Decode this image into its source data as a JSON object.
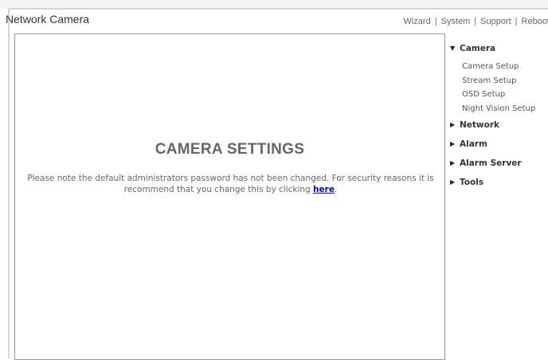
{
  "header": {
    "title": "Network Camera",
    "nav": [
      "Wizard",
      "System",
      "Support",
      "Reboot"
    ],
    "separator": "|"
  },
  "content": {
    "title": "CAMERA SETTINGS",
    "message": "Please note the default administrators password has not been changed. For security reasons it is recommend that you change this by clicking ",
    "link_text": "here",
    "message_end": "."
  },
  "sidebar": {
    "sections": [
      {
        "label": "Camera",
        "expanded": true,
        "items": [
          "Camera Setup",
          "Stream Setup",
          "OSD Setup",
          "Night Vision Setup"
        ]
      },
      {
        "label": "Network",
        "expanded": false
      },
      {
        "label": "Alarm",
        "expanded": false
      },
      {
        "label": "Alarm Server",
        "expanded": false
      },
      {
        "label": "Tools",
        "expanded": false
      }
    ],
    "icons": {
      "expanded": "triangle-down-icon",
      "collapsed": "triangle-right-icon"
    }
  }
}
